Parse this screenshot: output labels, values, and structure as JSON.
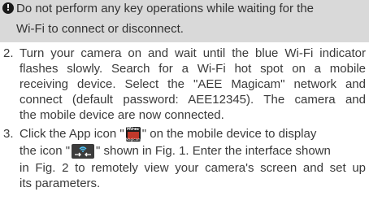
{
  "note": {
    "icon": "exclamation-icon",
    "lines": [
      "Do not perform any key operations while waiting for the",
      "Wi-Fi to connect or disconnect."
    ]
  },
  "steps": [
    {
      "number": "2.",
      "lines": [
        "Turn your camera on and wait until the blue Wi-Fi indicator",
        "flashes slowly. Search for a Wi-Fi hot spot on a mobile",
        "receiving device. Select the \"AEE Magicam\" network and",
        "connect (default password: AEE12345). The camera and",
        "the mobile device are now connected."
      ]
    },
    {
      "number": "3.",
      "line1_before": "Click the App icon \"",
      "line1_after": "\" on the mobile device to display",
      "line2_before": "the icon \"",
      "line2_after": "\" shown in Fig. 1. Enter the interface shown",
      "lines_rest": [
        "in Fig. 2 to remotely view your camera's screen and set up",
        "its parameters."
      ],
      "app_icon": {
        "name": "magicam-app-icon",
        "logo_text": "Mirec",
        "sub_text": "Magicam"
      },
      "wifi_icon": {
        "name": "wifi-connect-icon"
      }
    }
  ]
}
